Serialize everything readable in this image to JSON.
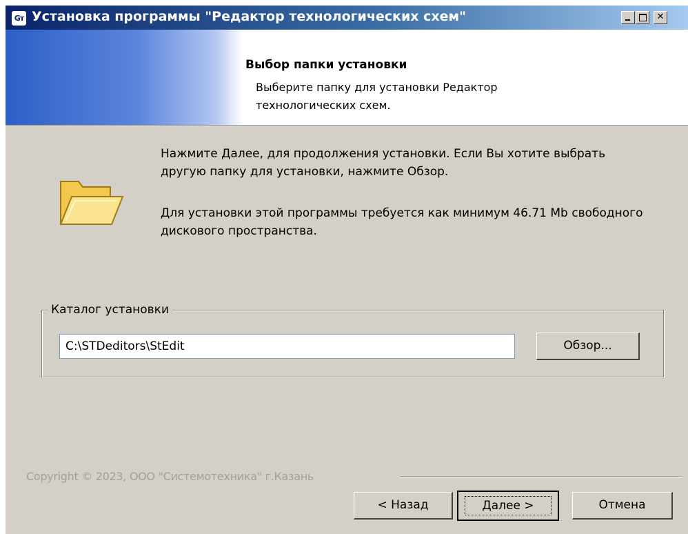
{
  "window": {
    "title": "Установка программы \"Редактор технологических схем\"",
    "icon_text": "Gт"
  },
  "header": {
    "title": "Выбор папки установки",
    "subtitle": "Выберите папку для установки Редактор технологических схем."
  },
  "body": {
    "instruction": "Нажмите Далее, для продолжения установки. Если Вы хотите выбрать другую папку для установки, нажмите Обзор.",
    "space_required": "Для установки этой программы требуется как минимум 46.71 Mb свободного дискового пространства."
  },
  "install_dir": {
    "group_label": "Каталог установки",
    "path_value": "C:\\STDeditors\\StEdit",
    "browse_label": "Обзор..."
  },
  "footer": {
    "copyright": "Copyright © 2023, ООО \"Системотехника\" г.Казань",
    "back_label": "< Назад",
    "next_label": "Далее >",
    "cancel_label": "Отмена"
  },
  "colors": {
    "titlebar_start": "#0a246a",
    "titlebar_end": "#a6caf0",
    "dialog_bg": "#d4d0c8",
    "folder_fill": "#f7d96b"
  }
}
